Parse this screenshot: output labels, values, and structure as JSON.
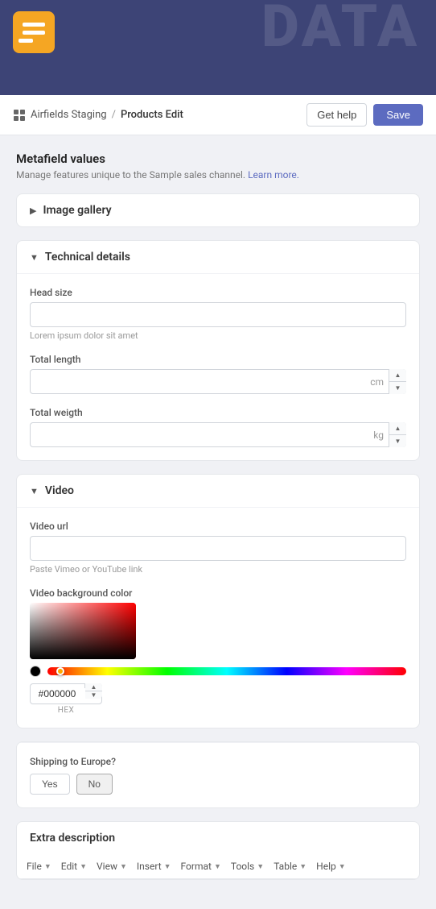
{
  "topBar": {
    "dataText": "DATA",
    "logoAlt": "App logo"
  },
  "breadcrumb": {
    "appName": "Airfields Staging",
    "separator": "/",
    "currentPage": "Products Edit",
    "getHelpLabel": "Get help",
    "saveLabel": "Save"
  },
  "metafield": {
    "title": "Metafield values",
    "subtitle": "Manage features unique to the Sample sales channel.",
    "learnMore": "Learn more."
  },
  "imageGallery": {
    "title": "Image gallery",
    "collapsed": true
  },
  "technicalDetails": {
    "title": "Technical details",
    "collapsed": false,
    "headSize": {
      "label": "Head size",
      "value": "",
      "hint": "Lorem ipsum dolor sit amet"
    },
    "totalLength": {
      "label": "Total length",
      "value": "",
      "unit": "cm"
    },
    "totalWeight": {
      "label": "Total weigth",
      "value": "",
      "unit": "kg"
    }
  },
  "video": {
    "title": "Video",
    "collapsed": false,
    "videoUrl": {
      "label": "Video url",
      "value": "",
      "placeholder": "",
      "hint": "Paste Vimeo or YouTube link"
    },
    "bgColor": {
      "label": "Video background color",
      "hexValue": "#000000",
      "hexLabel": "HEX"
    }
  },
  "shipping": {
    "question": "Shipping to Europe?",
    "yesLabel": "Yes",
    "noLabel": "No",
    "selectedNo": true
  },
  "extraDescription": {
    "title": "Extra description",
    "toolbar": {
      "file": "File",
      "edit": "Edit",
      "view": "View",
      "insert": "Insert",
      "format": "Format",
      "tools": "Tools",
      "table": "Table",
      "help": "Help"
    }
  },
  "icons": {
    "chevronRight": "▶",
    "chevronDown": "▼",
    "gridIcon": "⊞",
    "spinnerUp": "▲",
    "spinnerDown": "▼",
    "menuCaret": "▼"
  }
}
